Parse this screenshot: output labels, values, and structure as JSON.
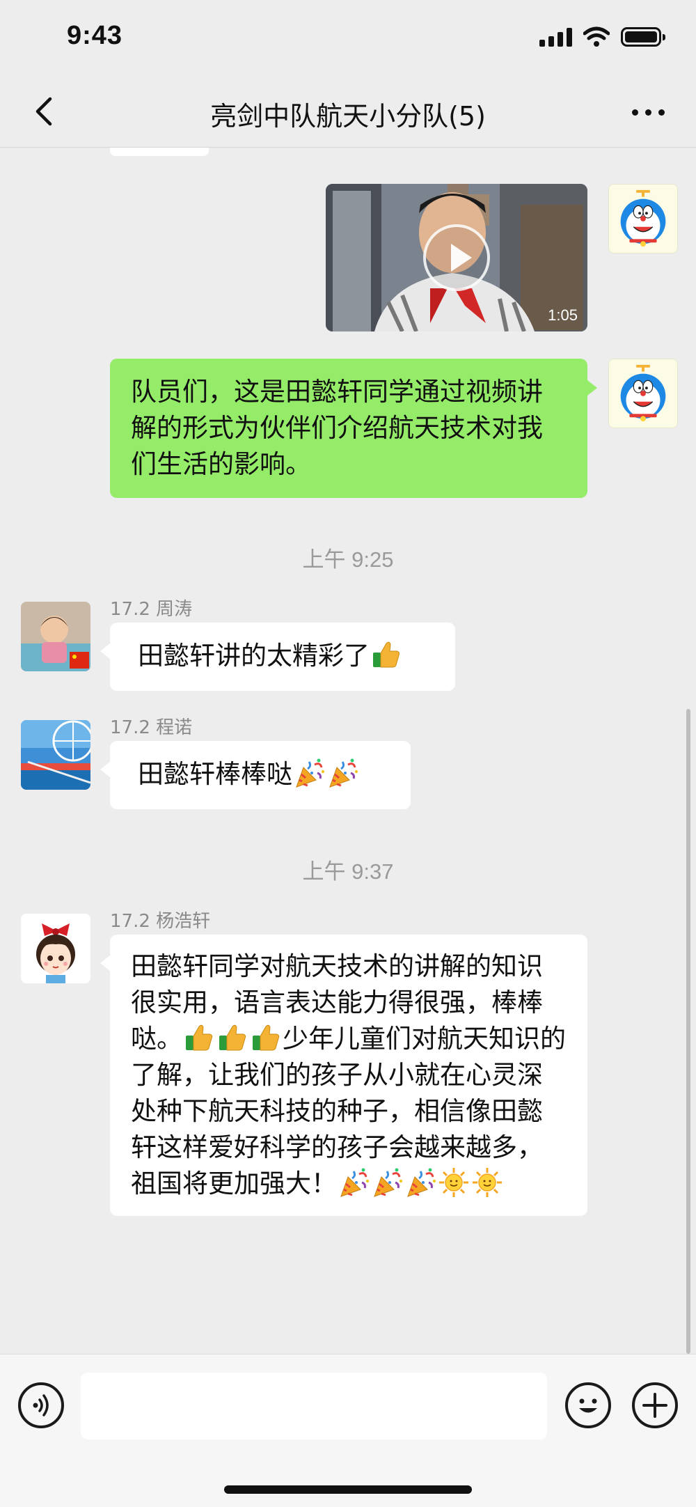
{
  "status_bar": {
    "time": "9:43"
  },
  "nav": {
    "title": "亮剑中队航天小分队(5)"
  },
  "messages": {
    "video": {
      "duration": "1:05"
    },
    "teacher_text": "队员们，这是田懿轩同学通过视频讲解的形式为伙伴们介绍航天技术对我们生活的影响。",
    "time_1": "上午 9:25",
    "msg1": {
      "sender": "17.2 周涛",
      "text": "田懿轩讲的太精彩了"
    },
    "msg2": {
      "sender": "17.2 程诺",
      "text": "田懿轩棒棒哒"
    },
    "time_2": "上午 9:37",
    "msg3": {
      "sender": "17.2 杨浩轩",
      "text_part1": "田懿轩同学对航天技术的讲解的知识很实用，语言表达能力得很强，棒棒哒。",
      "text_part2": "少年儿童们对航天知识的了解，让我们的孩子从小就在心灵深处种下航天科技的种子，相信像田懿轩这样爱好科学的孩子会越来越多，祖国将更加强大！"
    }
  },
  "icons": {
    "thumbs_up": "thumbs-up-icon",
    "party_popper": "party-popper-icon",
    "sun": "sun-icon"
  },
  "colors": {
    "my_bubble": "#95ec69",
    "other_bubble": "#ffffff",
    "background": "#ededed"
  },
  "input": {
    "value": ""
  }
}
